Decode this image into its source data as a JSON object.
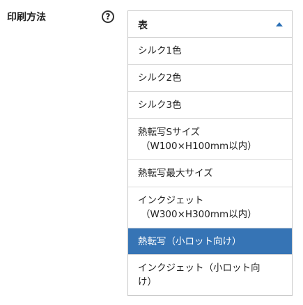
{
  "field": {
    "label": "印刷方法",
    "help": "?"
  },
  "select": {
    "value": "表",
    "options": [
      {
        "line1": "シルク1色",
        "line2": ""
      },
      {
        "line1": "シルク2色",
        "line2": ""
      },
      {
        "line1": "シルク3色",
        "line2": ""
      },
      {
        "line1": "熱転写Sサイズ",
        "line2": "（W100×H100mm以内）"
      },
      {
        "line1": "熱転写最大サイズ",
        "line2": ""
      },
      {
        "line1": "インクジェット",
        "line2": "（W300×H300mm以内）"
      },
      {
        "line1": "熱転写（小ロット向け）",
        "line2": ""
      },
      {
        "line1": "インクジェット（小ロット向",
        "line2": "け）"
      }
    ],
    "selected_index": 6,
    "colors": {
      "accent": "#3674b5",
      "border": "#c8c8c8"
    }
  }
}
